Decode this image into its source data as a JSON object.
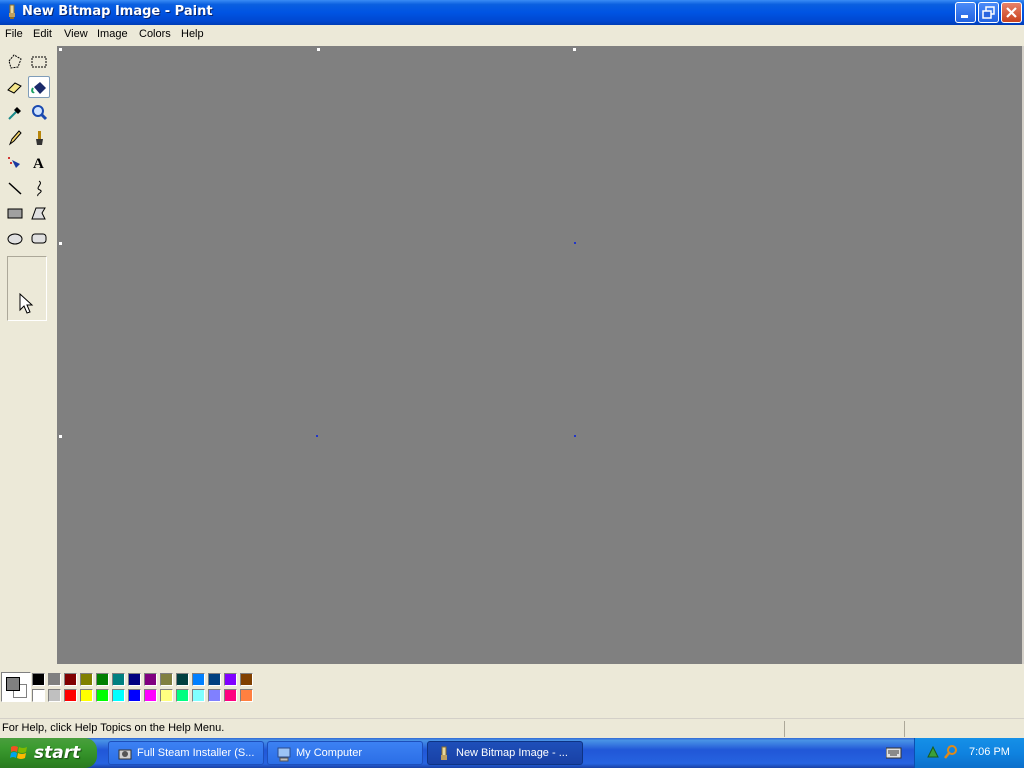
{
  "window": {
    "title": "New Bitmap Image - Paint"
  },
  "menu": [
    "File",
    "Edit",
    "View",
    "Image",
    "Colors",
    "Help"
  ],
  "tools": [
    {
      "name": "free-form-select-icon"
    },
    {
      "name": "select-icon"
    },
    {
      "name": "eraser-icon"
    },
    {
      "name": "fill-with-color-icon",
      "active": true
    },
    {
      "name": "pick-color-icon"
    },
    {
      "name": "magnifier-icon"
    },
    {
      "name": "pencil-icon"
    },
    {
      "name": "brush-icon"
    },
    {
      "name": "airbrush-icon"
    },
    {
      "name": "text-icon"
    },
    {
      "name": "line-icon"
    },
    {
      "name": "curve-icon"
    },
    {
      "name": "rectangle-icon"
    },
    {
      "name": "polygon-icon"
    },
    {
      "name": "ellipse-icon"
    },
    {
      "name": "rounded-rectangle-icon"
    }
  ],
  "colors": {
    "foreground": "#808080",
    "background": "#ffffff",
    "palette_top": [
      "#000000",
      "#808080",
      "#800000",
      "#808000",
      "#008000",
      "#008080",
      "#000080",
      "#800080",
      "#808040",
      "#004040",
      "#0080ff",
      "#004080",
      "#8000ff",
      "#804000"
    ],
    "palette_bottom": [
      "#ffffff",
      "#c0c0c0",
      "#ff0000",
      "#ffff00",
      "#00ff00",
      "#00ffff",
      "#0000ff",
      "#ff00ff",
      "#ffff80",
      "#00ff80",
      "#80ffff",
      "#8080ff",
      "#ff0080",
      "#ff8040"
    ]
  },
  "status": {
    "text": "For Help, click Help Topics on the Help Menu."
  },
  "taskbar": {
    "start_label": "start",
    "tasks": [
      {
        "label": "Full Steam Installer (S..."
      },
      {
        "label": "My Computer"
      },
      {
        "label": "New Bitmap Image - ..."
      }
    ],
    "clock": "7:06 PM"
  }
}
